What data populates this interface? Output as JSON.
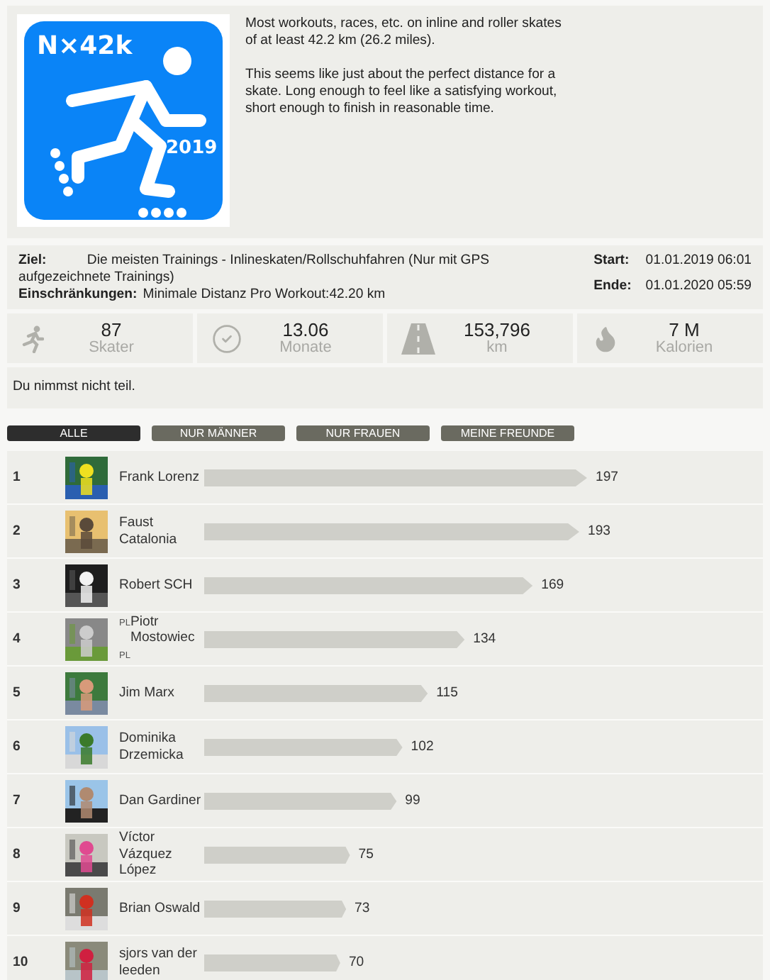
{
  "badge": {
    "title": "N×42k",
    "year": "2019"
  },
  "description": [
    "Most workouts, races, etc. on inline and roller skates of at least 42.2 km (26.2 miles).",
    "This seems like just about the perfect distance for a skate. Long enough to feel like a satisfying workout, short enough to finish in reasonable time."
  ],
  "details": {
    "goal": "**Ziel:** Die meisten Trainings - Inlineskaten/Rollschuhfahren  (Nur mit GPS aufgezeichnete Trainings)",
    "limits_label": "Einschränkungen:",
    "limits": "Minimale Distanz Pro Workout:42.20 km",
    "start_label": "Start:",
    "start": "01.01.2019 06:01",
    "end_label": "Ende:",
    "end": "01.01.2020 05:59"
  },
  "stats": [
    {
      "kind": "skater",
      "value": "87",
      "unit": "Skater"
    },
    {
      "kind": "check",
      "value": "13.06",
      "unit": "Monate"
    },
    {
      "kind": "road",
      "value": "153,796",
      "unit": "km"
    },
    {
      "kind": "flame",
      "value": "7 M",
      "unit": "Kalorien"
    }
  ],
  "participation": "Du nimmst nicht teil.",
  "filters": [
    {
      "label": "ALLE",
      "selected": true
    },
    {
      "label": "NUR MÄNNER",
      "selected": false
    },
    {
      "label": "NUR FRAUEN",
      "selected": false
    },
    {
      "label": "MEINE FREUNDE",
      "selected": false
    }
  ],
  "ranking": [
    {
      "rank": "1",
      "name": "Frank Lorenz",
      "count": "197"
    },
    {
      "rank": "2",
      "name": "Faust Catalonia",
      "count": "193"
    },
    {
      "rank": "3",
      "name": "Robert SCH",
      "count": "169"
    },
    {
      "rank": "4",
      "prefix": "PL",
      "name": "Piotr Mostowiec",
      "suffix": "PL",
      "count": "134"
    },
    {
      "rank": "5",
      "name": "Jim Marx",
      "count": "115"
    },
    {
      "rank": "6",
      "name": "Dominika Drzemicka",
      "count": "102"
    },
    {
      "rank": "7",
      "name": "Dan Gardiner",
      "count": "99"
    },
    {
      "rank": "8",
      "name": "Víctor Vázquez López",
      "count": "75"
    },
    {
      "rank": "9",
      "name": "Brian Oswald",
      "count": "73"
    },
    {
      "rank": "10",
      "name": "sjors van der leeden",
      "count": "70"
    }
  ]
}
